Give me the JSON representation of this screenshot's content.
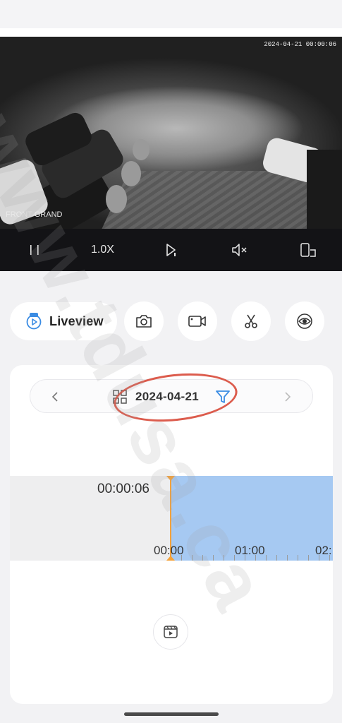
{
  "video": {
    "timestamp": "2024-04-21  00:00:06",
    "camera_name": "FRONT GRAND"
  },
  "player_bar": {
    "pause_icon": "pause-icon",
    "zoom_label": "1.0X",
    "speed_icon": "play-speed-icon",
    "mute_icon": "mute-icon",
    "rotate_icon": "rotate-screen-icon"
  },
  "actions": {
    "liveview_label": "Liveview",
    "buttons": [
      "camera-icon",
      "record-icon",
      "scissors-icon",
      "eye-icon"
    ]
  },
  "playback": {
    "date": "2024-04-21",
    "current_time": "00:00:06",
    "ticks": [
      "00:00",
      "01:00",
      "02:"
    ],
    "filter_icon": "filter-icon",
    "grid_icon": "grid-icon"
  },
  "watermark": "www.tdusa.ca",
  "colors": {
    "accent": "#3b8ce3",
    "timeline_blue": "#a6c9f2",
    "cursor": "#f4a23a",
    "annotation": "#d84a3a"
  }
}
